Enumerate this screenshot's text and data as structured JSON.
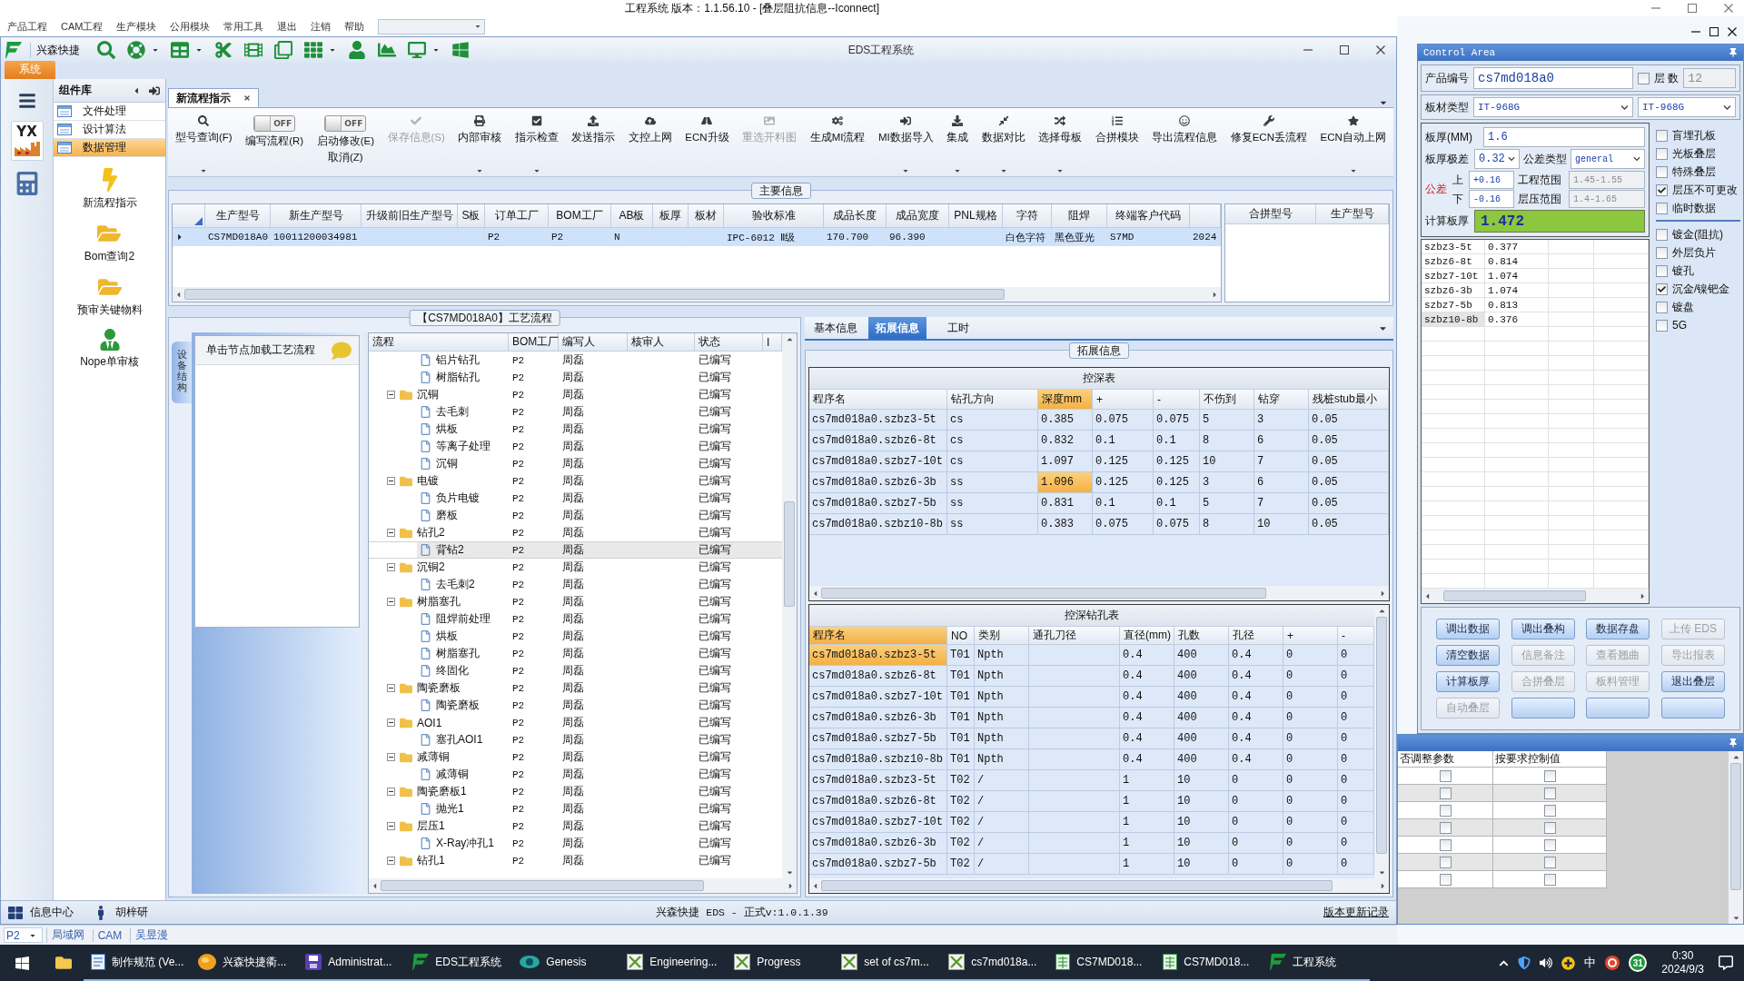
{
  "app_title": "工程系统  版本：1.1.56.10 - [叠层阻抗信息--Iconnect]",
  "menu": [
    "产品工程",
    "CAM工程",
    "生产模块",
    "公用模块",
    "常用工具",
    "退出",
    "注销",
    "帮助"
  ],
  "eds": {
    "title": "EDS工程系统",
    "brand": "兴森快捷",
    "system_tab": "系统"
  },
  "rail": {
    "logo_text": "YX"
  },
  "sidebar": {
    "title": "组件库",
    "items": [
      {
        "label": "文件处理",
        "selected": false
      },
      {
        "label": "设计算法",
        "selected": false
      },
      {
        "label": "数据管理",
        "selected": true
      }
    ],
    "shortcuts": [
      "新流程指示",
      "Bom查询2",
      "预审关键物料",
      "Nope单审核"
    ]
  },
  "doc_tab": "新流程指示",
  "ribbon": [
    {
      "kind": "button",
      "label": "型号查询(F)",
      "dropdown": true,
      "disabled": false
    },
    {
      "kind": "toggle",
      "label": "编写流程(R)",
      "switch_text": "OFF",
      "on": false
    },
    {
      "kind": "toggle",
      "label": "启动修改(E)",
      "sublabel": "取消(Z)",
      "switch_text": "OFF",
      "on": false
    },
    {
      "kind": "button",
      "label": "保存信息(S)",
      "dropdown": false,
      "disabled": true
    },
    {
      "kind": "button",
      "label": "内部审核",
      "dropdown": true,
      "disabled": false
    },
    {
      "kind": "button",
      "label": "指示检查",
      "dropdown": true,
      "disabled": false
    },
    {
      "kind": "button",
      "label": "发送指示",
      "dropdown": false,
      "disabled": false
    },
    {
      "kind": "button",
      "label": "文控上网",
      "dropdown": false,
      "disabled": false
    },
    {
      "kind": "button",
      "label": "ECN升级",
      "dropdown": false,
      "disabled": false
    },
    {
      "kind": "button",
      "label": "重选开料图",
      "dropdown": false,
      "disabled": true
    },
    {
      "kind": "button",
      "label": "生成MI流程",
      "dropdown": false,
      "disabled": false
    },
    {
      "kind": "button",
      "label": "MI数据导入",
      "dropdown": true,
      "disabled": false
    },
    {
      "kind": "button",
      "label": "集成",
      "dropdown": true,
      "disabled": false
    },
    {
      "kind": "button",
      "label": "数据对比",
      "dropdown": true,
      "disabled": false
    },
    {
      "kind": "button",
      "label": "选择母板",
      "dropdown": true,
      "disabled": false
    },
    {
      "kind": "button",
      "label": "合拼模块",
      "dropdown": false,
      "disabled": false
    },
    {
      "kind": "button",
      "label": "导出流程信息",
      "dropdown": false,
      "disabled": false
    },
    {
      "kind": "button",
      "label": "修复ECN丢流程",
      "dropdown": false,
      "disabled": false
    },
    {
      "kind": "button",
      "label": "ECN自动上网",
      "dropdown": true,
      "disabled": false
    }
  ],
  "main_info": {
    "title": "主要信息",
    "columns": [
      "生产型号",
      "新生产型号",
      "升级前旧生产型号",
      "S板",
      "订单工厂",
      "BOM工厂",
      "AB板",
      "板厚",
      "板材",
      "验收标准",
      "成品长度",
      "成品宽度",
      "PNL规格",
      "字符",
      "阻焊",
      "终端客户代码"
    ],
    "rows": [
      {
        "selected": true,
        "cells": [
          "CS7MD018A0",
          "10011200034981",
          null,
          null,
          "P2",
          "P2",
          "N",
          null,
          null,
          "IPC-6012 Ⅱ级",
          "170.700",
          "96.390",
          null,
          "白色字符",
          "黑色亚光",
          "S7MD",
          "2024"
        ]
      }
    ],
    "side_columns": [
      "合拼型号",
      "生产型号"
    ]
  },
  "process": {
    "title": "【CS7MD018A0】工艺流程",
    "side_tab": "设备结构",
    "hint": "单击节点加载工艺流程",
    "columns": [
      "流程",
      "BOM工厂",
      "编写人",
      "核审人",
      "状态",
      "I"
    ],
    "tree": [
      {
        "children": [
          {
            "kind": "file",
            "label": "铝片钻孔",
            "bom": "P2",
            "writer": "周磊",
            "status": "已编写",
            "selected": false
          },
          {
            "kind": "file",
            "label": "树脂钻孔",
            "bom": "P2",
            "writer": "周磊",
            "status": "已编写",
            "selected": false
          }
        ]
      },
      {
        "kind": "folder",
        "label": "沉铜",
        "bom": "P2",
        "writer": "周磊",
        "status": "已编写",
        "selected": false,
        "expanded": true,
        "children": [
          {
            "kind": "file",
            "label": "去毛刺",
            "bom": "P2",
            "writer": "周磊",
            "status": "已编写",
            "selected": false
          },
          {
            "kind": "file",
            "label": "烘板",
            "bom": "P2",
            "writer": "周磊",
            "status": "已编写",
            "selected": false
          },
          {
            "kind": "file",
            "label": "等离子处理",
            "bom": "P2",
            "writer": "周磊",
            "status": "已编写",
            "selected": false
          },
          {
            "kind": "file",
            "label": "沉铜",
            "bom": "P2",
            "writer": "周磊",
            "status": "已编写",
            "selected": false
          }
        ]
      },
      {
        "kind": "folder",
        "label": "电镀",
        "bom": "P2",
        "writer": "周磊",
        "status": "已编写",
        "selected": false,
        "expanded": true,
        "children": [
          {
            "kind": "file",
            "label": "负片电镀",
            "bom": "P2",
            "writer": "周磊",
            "status": "已编写",
            "selected": false
          },
          {
            "kind": "file",
            "label": "磨板",
            "bom": "P2",
            "writer": "周磊",
            "status": "已编写",
            "selected": false
          }
        ]
      },
      {
        "kind": "folder",
        "label": "钻孔2",
        "bom": "P2",
        "writer": "周磊",
        "status": "已编写",
        "selected": false,
        "expanded": true,
        "children": [
          {
            "kind": "file",
            "label": "背钻2",
            "bom": "P2",
            "writer": "周磊",
            "status": "已编写",
            "selected": true
          }
        ]
      },
      {
        "kind": "folder",
        "label": "沉铜2",
        "bom": "P2",
        "writer": "周磊",
        "status": "已编写",
        "selected": false,
        "expanded": true,
        "children": [
          {
            "kind": "file",
            "label": "去毛刺2",
            "bom": "P2",
            "writer": "周磊",
            "status": "已编写",
            "selected": false
          }
        ]
      },
      {
        "kind": "folder",
        "label": "树脂塞孔",
        "bom": "P2",
        "writer": "周磊",
        "status": "已编写",
        "selected": false,
        "expanded": true,
        "children": [
          {
            "kind": "file",
            "label": "阻焊前处理",
            "bom": "P2",
            "writer": "周磊",
            "status": "已编写",
            "selected": false
          },
          {
            "kind": "file",
            "label": "烘板",
            "bom": "P2",
            "writer": "周磊",
            "status": "已编写",
            "selected": false
          },
          {
            "kind": "file",
            "label": "树脂塞孔",
            "bom": "P2",
            "writer": "周磊",
            "status": "已编写",
            "selected": false
          },
          {
            "kind": "file",
            "label": "终固化",
            "bom": "P2",
            "writer": "周磊",
            "status": "已编写",
            "selected": false
          }
        ]
      },
      {
        "kind": "folder",
        "label": "陶瓷磨板",
        "bom": "P2",
        "writer": "周磊",
        "status": "已编写",
        "selected": false,
        "expanded": true,
        "children": [
          {
            "kind": "file",
            "label": "陶瓷磨板",
            "bom": "P2",
            "writer": "周磊",
            "status": "已编写",
            "selected": false
          }
        ]
      },
      {
        "kind": "folder",
        "label": "AOI1",
        "bom": "P2",
        "writer": "周磊",
        "status": "已编写",
        "selected": false,
        "expanded": true,
        "children": [
          {
            "kind": "file",
            "label": "塞孔AOI1",
            "bom": "P2",
            "writer": "周磊",
            "status": "已编写",
            "selected": false
          }
        ]
      },
      {
        "kind": "folder",
        "label": "减薄铜",
        "bom": "P2",
        "writer": "周磊",
        "status": "已编写",
        "selected": false,
        "expanded": true,
        "children": [
          {
            "kind": "file",
            "label": "减薄铜",
            "bom": "P2",
            "writer": "周磊",
            "status": "已编写",
            "selected": false
          }
        ]
      },
      {
        "kind": "folder",
        "label": "陶瓷磨板1",
        "bom": "P2",
        "writer": "周磊",
        "status": "已编写",
        "selected": false,
        "expanded": true,
        "children": [
          {
            "kind": "file",
            "label": "抛光1",
            "bom": "P2",
            "writer": "周磊",
            "status": "已编写",
            "selected": false
          }
        ]
      },
      {
        "kind": "folder",
        "label": "层压1",
        "bom": "P2",
        "writer": "周磊",
        "status": "已编写",
        "selected": false,
        "expanded": true,
        "children": [
          {
            "kind": "file",
            "label": "X-Ray冲孔1",
            "bom": "P2",
            "writer": "周磊",
            "status": "已编写",
            "selected": false
          }
        ]
      },
      {
        "kind": "folder",
        "label": "钻孔1",
        "bom": "P2",
        "writer": "周磊",
        "status": "已编写",
        "selected": false,
        "expanded": true
      }
    ]
  },
  "detail": {
    "tabs": [
      {
        "label": "基本信息",
        "selected": false
      },
      {
        "label": "拓展信息",
        "selected": true
      },
      {
        "label": "工时",
        "selected": false
      }
    ],
    "group_title": "拓展信息",
    "depth_table": {
      "title": "控深表",
      "columns": [
        {
          "label": "程序名",
          "selected": false
        },
        {
          "label": "钻孔方向",
          "selected": false
        },
        {
          "label": "深度mm",
          "selected": true
        },
        {
          "label": "+",
          "selected": false
        },
        {
          "label": "-",
          "selected": false
        },
        {
          "label": "不伤到",
          "selected": false
        },
        {
          "label": "钻穿",
          "selected": false
        },
        {
          "label": "残桩stub最小",
          "selected": false
        }
      ],
      "rows": [
        {
          "selected": false,
          "cells": [
            "cs7md018a0.szbz3-5t",
            "cs",
            "0.385",
            "0.075",
            "0.075",
            "5",
            "3",
            "0.05"
          ]
        },
        {
          "selected": false,
          "cells": [
            "cs7md018a0.szbz6-8t",
            "cs",
            "0.832",
            "0.1",
            "0.1",
            "8",
            "6",
            "0.05"
          ]
        },
        {
          "selected": false,
          "cells": [
            "cs7md018a0.szbz7-10t",
            "cs",
            "1.097",
            "0.125",
            "0.125",
            "10",
            "7",
            "0.05"
          ]
        },
        {
          "selected": true,
          "cells": [
            "cs7md018a0.szbz6-3b",
            "ss",
            "1.096",
            "0.125",
            "0.125",
            "3",
            "6",
            "0.05"
          ]
        },
        {
          "selected": false,
          "cells": [
            "cs7md018a0.szbz7-5b",
            "ss",
            "0.831",
            "0.1",
            "0.1",
            "5",
            "7",
            "0.05"
          ]
        },
        {
          "selected": false,
          "cells": [
            "cs7md018a0.szbz10-8b",
            "ss",
            "0.383",
            "0.075",
            "0.075",
            "8",
            "10",
            "0.05"
          ]
        }
      ]
    },
    "drill_table": {
      "title": "控深钻孔表",
      "columns": [
        {
          "label": "程序名",
          "selected": true
        },
        {
          "label": "NO",
          "selected": false
        },
        {
          "label": "类别",
          "selected": false
        },
        {
          "label": "通孔刀径",
          "selected": false
        },
        {
          "label": "直径(mm)",
          "selected": false
        },
        {
          "label": "孔数",
          "selected": false
        },
        {
          "label": "孔径",
          "selected": false
        },
        {
          "label": "+",
          "selected": false
        },
        {
          "label": "-",
          "selected": false
        }
      ],
      "rows": [
        {
          "selected": true,
          "cells": [
            "cs7md018a0.szbz3-5t",
            "T01",
            "Npth",
            null,
            "0.4",
            "400",
            "0.4",
            "0",
            "0"
          ]
        },
        {
          "selected": false,
          "cells": [
            "cs7md018a0.szbz6-8t",
            "T01",
            "Npth",
            null,
            "0.4",
            "400",
            "0.4",
            "0",
            "0"
          ]
        },
        {
          "selected": false,
          "cells": [
            "cs7md018a0.szbz7-10t",
            "T01",
            "Npth",
            null,
            "0.4",
            "400",
            "0.4",
            "0",
            "0"
          ]
        },
        {
          "selected": false,
          "cells": [
            "cs7md018a0.szbz6-3b",
            "T01",
            "Npth",
            null,
            "0.4",
            "400",
            "0.4",
            "0",
            "0"
          ]
        },
        {
          "selected": false,
          "cells": [
            "cs7md018a0.szbz7-5b",
            "T01",
            "Npth",
            null,
            "0.4",
            "400",
            "0.4",
            "0",
            "0"
          ]
        },
        {
          "selected": false,
          "cells": [
            "cs7md018a0.szbz10-8b",
            "T01",
            "Npth",
            null,
            "0.4",
            "400",
            "0.4",
            "0",
            "0"
          ]
        },
        {
          "selected": false,
          "cells": [
            "cs7md018a0.szbz3-5t",
            "T02",
            "/",
            null,
            "1",
            "10",
            "0",
            "0",
            "0"
          ]
        },
        {
          "selected": false,
          "cells": [
            "cs7md018a0.szbz6-8t",
            "T02",
            "/",
            null,
            "1",
            "10",
            "0",
            "0",
            "0"
          ]
        },
        {
          "selected": false,
          "cells": [
            "cs7md018a0.szbz7-10t",
            "T02",
            "/",
            null,
            "1",
            "10",
            "0",
            "0",
            "0"
          ]
        },
        {
          "selected": false,
          "cells": [
            "cs7md018a0.szbz6-3b",
            "T02",
            "/",
            null,
            "1",
            "10",
            "0",
            "0",
            "0"
          ]
        },
        {
          "selected": false,
          "cells": [
            "cs7md018a0.szbz7-5b",
            "T02",
            "/",
            null,
            "1",
            "10",
            "0",
            "0",
            "0"
          ]
        }
      ]
    }
  },
  "status_bar": {
    "items": [
      "信息中心",
      "胡梓研"
    ],
    "version": "兴森快捷 EDS - 正式v:1.0.1.39",
    "link": "版本更新记录"
  },
  "footer": {
    "site": "P2",
    "links": [
      "局域网",
      "CAM",
      "吴昱漫"
    ]
  },
  "control_area": {
    "title": "Control Area",
    "product_no": {
      "label": "产品编号",
      "value": "cs7md018a0"
    },
    "layers": {
      "label": "层 数",
      "checked": false,
      "value": "12"
    },
    "material": {
      "label": "板材类型",
      "value": "IT-968G",
      "value_2": "IT-968G"
    },
    "thickness": {
      "label": "板厚(MM)",
      "value": "1.6"
    },
    "range": {
      "label": "板厚极差",
      "value": "0.32"
    },
    "tol_type": {
      "label": "公差类型",
      "value": "general"
    },
    "tolerance": {
      "label": "公差",
      "upper_label": "上",
      "upper": "+0.16",
      "lower_label": "下",
      "lower": "-0.16"
    },
    "eng_range": {
      "label": "工程范围",
      "value": "1.45-1.55"
    },
    "press_range": {
      "label": "层压范围",
      "value": "1.4-1.65"
    },
    "calc": {
      "label": "计算板厚",
      "value": "1.472"
    },
    "thickness_rows": [
      {
        "selected": false,
        "cells": [
          "szbz3-5t",
          "0.377"
        ]
      },
      {
        "selected": false,
        "cells": [
          "szbz6-8t",
          "0.814"
        ]
      },
      {
        "selected": false,
        "cells": [
          "szbz7-10t",
          "1.074"
        ]
      },
      {
        "selected": false,
        "cells": [
          "szbz6-3b",
          "1.074"
        ]
      },
      {
        "selected": false,
        "cells": [
          "szbz7-5b",
          "0.813"
        ]
      },
      {
        "selected": true,
        "cells": [
          "szbz10-8b",
          "0.376"
        ]
      }
    ],
    "check_groups": [
      [
        {
          "label": "盲埋孔板",
          "checked": false
        },
        {
          "label": "光板叠层",
          "checked": false
        },
        {
          "label": "特殊叠层",
          "checked": false
        },
        {
          "label": "层压不可更改",
          "checked": true
        },
        {
          "label": "临时数据",
          "checked": false
        }
      ],
      [
        {
          "label": "镀金(阻抗)",
          "checked": false
        },
        {
          "label": "外层负片",
          "checked": false
        },
        {
          "label": "镀孔",
          "checked": false
        },
        {
          "label": "沉金/镍钯金",
          "checked": true
        },
        {
          "label": "镀盘",
          "checked": false
        },
        {
          "label": "5G",
          "checked": false
        }
      ]
    ],
    "buttons": [
      {
        "label": "调出数据",
        "disabled": false
      },
      {
        "label": "调出叠构",
        "disabled": false
      },
      {
        "label": "数据存盘",
        "disabled": false
      },
      {
        "label": "上传 EDS",
        "disabled": true
      },
      {
        "label": "清空数据",
        "disabled": false
      },
      {
        "label": "信息备注",
        "disabled": true
      },
      {
        "label": "查看翘曲",
        "disabled": true
      },
      {
        "label": "导出报表",
        "disabled": true
      },
      {
        "label": "计算板厚",
        "disabled": false
      },
      {
        "label": "合拼叠层",
        "disabled": true
      },
      {
        "label": "板料管理",
        "disabled": true
      },
      {
        "label": "退出叠层",
        "disabled": false
      },
      {
        "label": "自动叠层",
        "disabled": true
      }
    ]
  },
  "param_panel": {
    "columns": [
      "否调整参数",
      "按要求控制值"
    ],
    "rows": [
      {
        "adjust": false,
        "control": false
      },
      {
        "adjust": false,
        "control": false
      },
      {
        "adjust": false,
        "control": false
      },
      {
        "adjust": false,
        "control": false
      },
      {
        "adjust": false,
        "control": false
      },
      {
        "adjust": false,
        "control": false
      },
      {
        "adjust": false,
        "control": false
      }
    ]
  },
  "taskbar": {
    "apps": [
      "制作规范 (Ve...",
      "兴森快捷衢...",
      "Administrat...",
      "EDS工程系统",
      "Genesis",
      "Engineering...",
      "Progress",
      "set of cs7m...",
      "cs7md018a...",
      "CS7MD018...",
      "CS7MD018...",
      "工程系统"
    ],
    "tray": {
      "ime": "中",
      "badge": "31",
      "time": "0:30",
      "date": "2024/9/3"
    }
  }
}
